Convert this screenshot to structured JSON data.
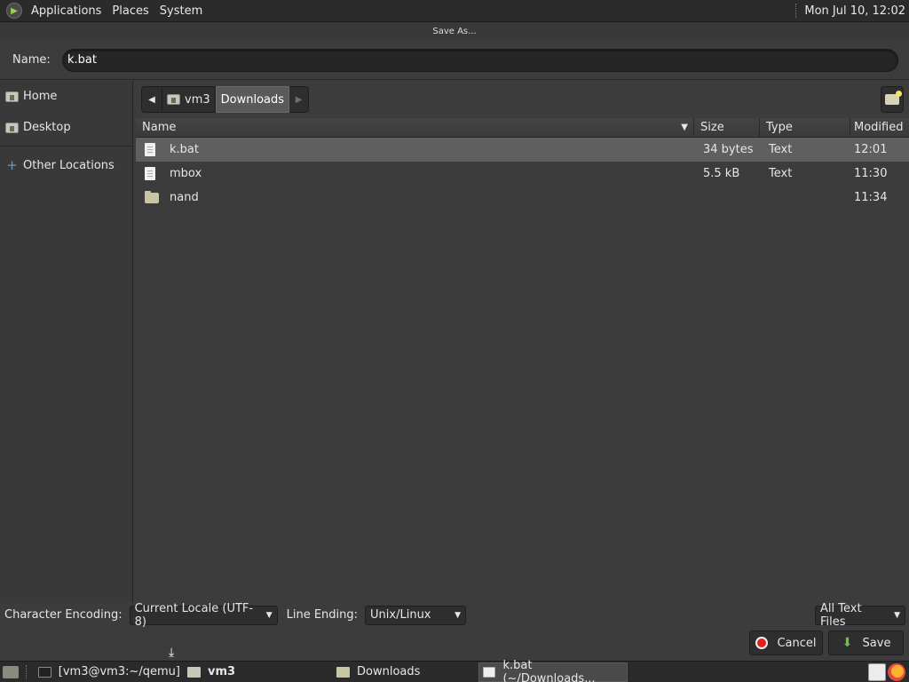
{
  "top_panel": {
    "menus": [
      "Applications",
      "Places",
      "System"
    ],
    "clock": "Mon Jul 10, 12:02"
  },
  "dialog": {
    "title": "Save As...",
    "name_label": "Name:",
    "name_value": "k.bat"
  },
  "sidebar": {
    "items": [
      {
        "label": "Home",
        "icon": "home-folder-icon"
      },
      {
        "label": "Desktop",
        "icon": "desktop-folder-icon"
      },
      {
        "label": "Other Locations",
        "icon": "plus-icon"
      }
    ]
  },
  "path_bar": {
    "segments": [
      "vm3",
      "Downloads"
    ],
    "active_segment": "Downloads"
  },
  "file_list": {
    "columns": [
      "Name",
      "Size",
      "Type",
      "Modified"
    ],
    "rows": [
      {
        "name": "k.bat",
        "size": "34 bytes",
        "type": "Text",
        "modified": "12:01",
        "kind": "file",
        "selected": true
      },
      {
        "name": "mbox",
        "size": "5.5 kB",
        "type": "Text",
        "modified": "11:30",
        "kind": "file",
        "selected": false
      },
      {
        "name": "nand",
        "size": "",
        "type": "",
        "modified": "11:34",
        "kind": "folder",
        "selected": false
      }
    ]
  },
  "options": {
    "encoding_label": "Character Encoding:",
    "encoding_value": "Current Locale (UTF-8)",
    "line_ending_label": "Line Ending:",
    "line_ending_value": "Unix/Linux",
    "filter_value": "All Text Files"
  },
  "buttons": {
    "cancel": "Cancel",
    "save": "Save"
  },
  "taskbar": {
    "tasks": [
      {
        "label": "[vm3@vm3:~/qemu]",
        "icon": "terminal-icon"
      },
      {
        "label": "vm3",
        "icon": "home-folder-icon"
      },
      {
        "label": "Downloads",
        "icon": "folder-icon"
      },
      {
        "label": "k.bat (~/Downloads...",
        "icon": "text-editor-icon"
      }
    ]
  },
  "colors": {
    "panel_bg": "#2b2b2b",
    "dialog_bg": "#3c3c3c",
    "selected_row": "#5f5f5f",
    "cancel_red": "#e02020",
    "save_green": "#6cc04a"
  }
}
